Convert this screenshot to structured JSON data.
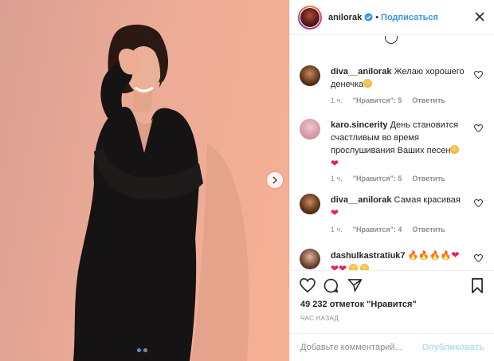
{
  "post": {
    "username": "anilorak",
    "separator": "•",
    "follow_label": "Подписаться",
    "verified_icon": "verified-badge-icon",
    "accent": "#3897f0",
    "carousel": {
      "count": 2,
      "active": 0
    }
  },
  "comments": [
    {
      "user": "diva__anilorak",
      "text": "Желаю хорошего денечка",
      "emoji": [
        "smiling-face-with-heart-eyes"
      ],
      "time": "1 ч.",
      "likes": "\"Нравится\": 5",
      "reply": "Ответить"
    },
    {
      "user": "karo.sincerity",
      "text": "День становится счастливым во время прослушивания Ваших песен",
      "emoji": [
        "smiling-face-with-heart-eyes",
        "red-heart"
      ],
      "time": "1 ч.",
      "likes": "\"Нравится\": 5",
      "reply": "Ответить"
    },
    {
      "user": "diva__anilorak",
      "text": "Самая красивая",
      "emoji": [
        "red-heart"
      ],
      "time": "1 ч.",
      "likes": "\"Нравится\": 4",
      "reply": "Ответить"
    },
    {
      "user": "dashulkastratiuk7",
      "text": "",
      "emoji": [
        "fire",
        "fire",
        "fire",
        "fire",
        "red-heart",
        "red-heart",
        "red-heart",
        "smiling-face",
        "smiling-face"
      ]
    }
  ],
  "likes_text": "49 232 отметок \"Нравится\"",
  "time_ago": "ЧАС НАЗАД",
  "comment_box": {
    "placeholder": "Добавьте комментарий...",
    "post_label": "Опубликовать"
  },
  "icons": {
    "like": "heart-icon",
    "comment": "comment-icon",
    "share": "share-icon",
    "save": "bookmark-icon",
    "more": "more-options-icon",
    "next": "chevron-right-icon"
  }
}
